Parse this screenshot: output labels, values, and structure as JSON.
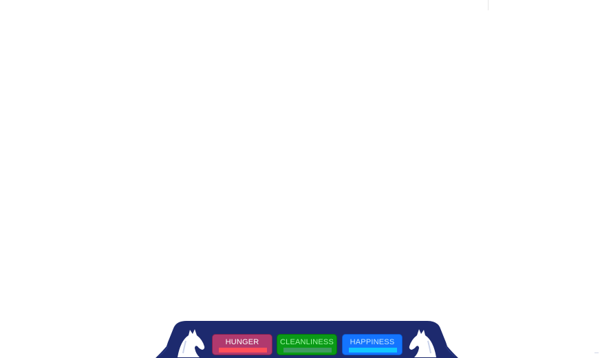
{
  "hud": {
    "stats": {
      "hunger": {
        "label": "HUNGER",
        "level": 1.0,
        "color": "#ff4f5a"
      },
      "cleanliness": {
        "label": "CLEANLINESS",
        "level": 1.0,
        "color": "#3f9a60"
      },
      "happiness": {
        "label": "HAPPINESS",
        "level": 1.0,
        "color": "#12c6ff"
      }
    },
    "icons": {
      "left": "horse-head-icon",
      "right": "horse-head-icon"
    },
    "panel_color": "#1d2a6e"
  }
}
